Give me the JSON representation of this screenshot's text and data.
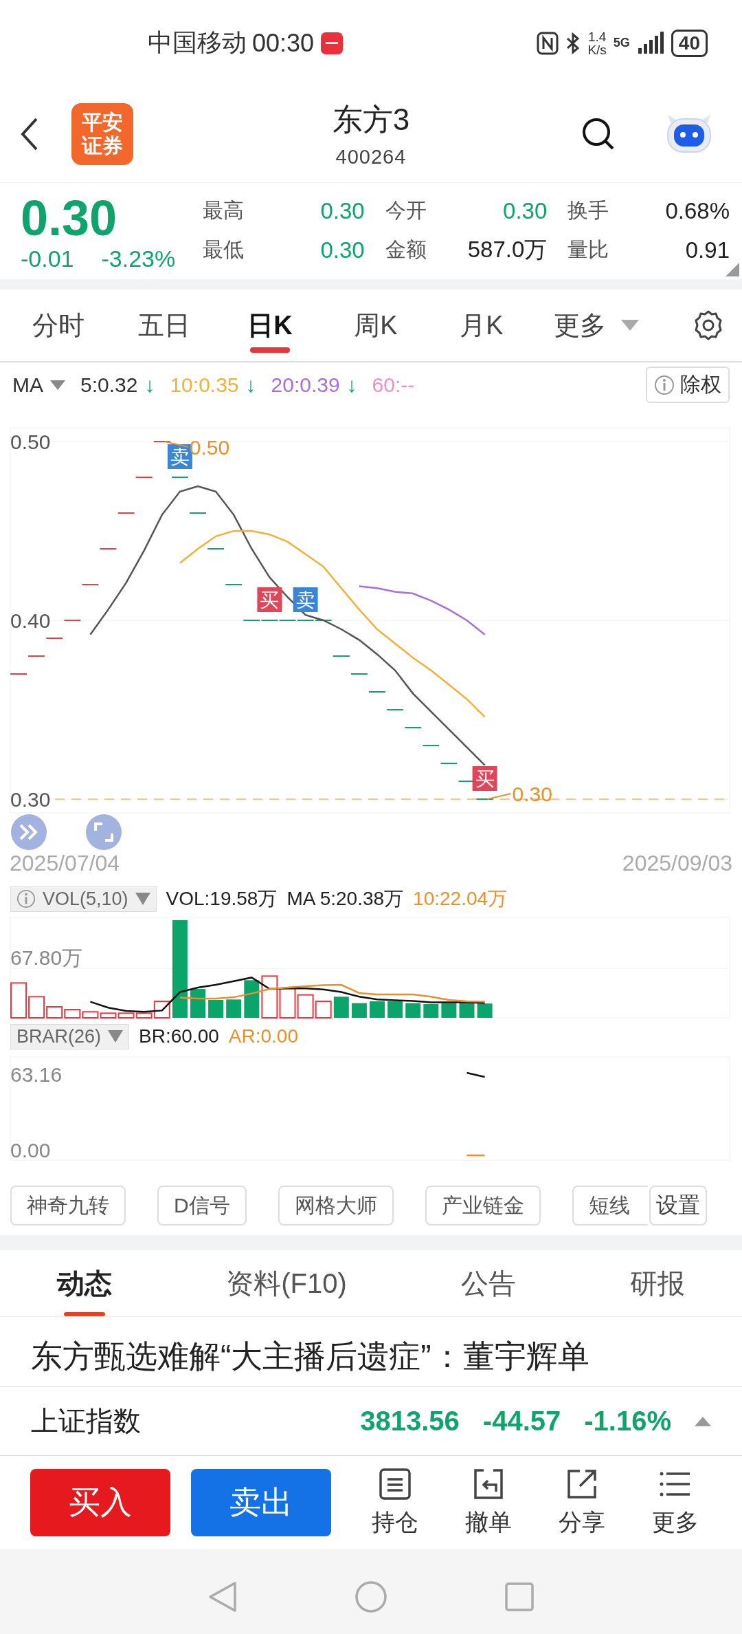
{
  "status_bar": {
    "carrier": "中国移动",
    "time": "00:30",
    "net_speed": "1.4",
    "net_unit": "K/s",
    "network": "5G",
    "battery": "40"
  },
  "header": {
    "logo_lines": [
      "平安",
      "证券"
    ],
    "title": "东方3",
    "code": "400264"
  },
  "quote": {
    "price": "0.30",
    "change": "-0.01",
    "change_pct": "-3.23%",
    "color": "#10a36c",
    "stats": [
      {
        "label": "最高",
        "value": "0.30",
        "color": "#10a36c"
      },
      {
        "label": "今开",
        "value": "0.30",
        "color": "#10a36c"
      },
      {
        "label": "换手",
        "value": "0.68%",
        "color": "#222222"
      },
      {
        "label": "最低",
        "value": "0.30",
        "color": "#10a36c"
      },
      {
        "label": "金额",
        "value": "587.0万",
        "color": "#222222"
      },
      {
        "label": "量比",
        "value": "0.91",
        "color": "#222222"
      }
    ]
  },
  "period_tabs": [
    {
      "label": "分时",
      "selected": false
    },
    {
      "label": "五日",
      "selected": false
    },
    {
      "label": "日K",
      "selected": true
    },
    {
      "label": "周K",
      "selected": false
    },
    {
      "label": "月K",
      "selected": false
    },
    {
      "label": "更多",
      "selected": false
    }
  ],
  "ma_legend": {
    "label": "MA",
    "items": [
      {
        "text": "5:0.32",
        "color": "#333333",
        "arrow": "↓"
      },
      {
        "text": "10:0.35",
        "color": "#f0b13a",
        "arrow": "↓"
      },
      {
        "text": "20:0.39",
        "color": "#a86fd6",
        "arrow": "↓"
      },
      {
        "text": "60:--",
        "color": "#ee8fc8"
      }
    ],
    "adjust_button": "除权"
  },
  "kline": {
    "chart_data": {
      "type": "line",
      "categories": [
        null,
        null,
        null,
        null,
        null,
        null,
        null,
        null,
        null,
        null,
        null,
        null,
        null,
        null,
        null,
        null,
        null,
        null,
        null,
        null,
        null,
        null,
        null,
        null,
        null,
        null,
        null
      ],
      "ylim": [
        0.3,
        0.5
      ],
      "yticks": [
        {
          "value": 0.3,
          "label": "0.30"
        },
        {
          "value": 0.4,
          "label": "0.40"
        },
        {
          "value": 0.5,
          "label": "0.50"
        }
      ],
      "series": [
        {
          "color": "#555555",
          "values": [
            null,
            null,
            null,
            null,
            0.392,
            0.406,
            0.421,
            0.439,
            0.459,
            0.472,
            0.475,
            0.472,
            0.459,
            0.44,
            0.424,
            0.413,
            0.403,
            0.4,
            0.395,
            0.389,
            0.381,
            0.372,
            0.359,
            0.349,
            0.339,
            0.329,
            0.319
          ]
        },
        {
          "color": "#f0b13a",
          "values": [
            null,
            null,
            null,
            null,
            null,
            null,
            null,
            null,
            null,
            0.432,
            0.44,
            0.447,
            0.45,
            0.45,
            0.448,
            0.444,
            0.437,
            0.43,
            0.418,
            0.406,
            0.395,
            0.387,
            0.379,
            0.372,
            0.364,
            0.356,
            0.346
          ]
        },
        {
          "color": "#a86fd6",
          "values": [
            null,
            null,
            null,
            null,
            null,
            null,
            null,
            null,
            null,
            null,
            null,
            null,
            null,
            null,
            null,
            null,
            null,
            null,
            null,
            0.419,
            0.418,
            0.416,
            0.415,
            0.411,
            0.406,
            0.4,
            0.392
          ]
        }
      ]
    },
    "high_label": "0.50",
    "low_label": "0.30",
    "x_start": "2025/07/04",
    "x_end": "2025/09/03",
    "signals": [
      {
        "kind": "sell",
        "label": "卖"
      },
      {
        "kind": "buy",
        "label": "买"
      },
      {
        "kind": "sell",
        "label": "卖"
      },
      {
        "kind": "buy",
        "label": "买"
      }
    ]
  },
  "volume": {
    "indicator": "VOL(5,10)",
    "readings": [
      {
        "text": "VOL:19.58万",
        "color": "#222222"
      },
      {
        "text": "MA 5:20.38万",
        "color": "#222222"
      },
      {
        "text": "10:22.04万",
        "color": "#e8902a"
      }
    ],
    "axis_label": "67.80万"
  },
  "brar": {
    "indicator": "BRAR(26)",
    "readings": [
      {
        "text": "BR:60.00",
        "color": "#222222"
      },
      {
        "text": "AR:0.00",
        "color": "#e8902a"
      }
    ],
    "axis_labels": [
      "63.16",
      "0.00"
    ]
  },
  "tools": [
    "神奇九转",
    "D信号",
    "网格大师",
    "产业链金",
    "短线"
  ],
  "tools_settings": "设置",
  "news_tabs": [
    {
      "label": "动态",
      "selected": true
    },
    {
      "label": "资料(F10)",
      "selected": false
    },
    {
      "label": "公告",
      "selected": false
    },
    {
      "label": "研报",
      "selected": false
    }
  ],
  "headline": "东方甄选难解“大主播后遗症”：董宇辉单",
  "index_bar": {
    "name": "上证指数",
    "value": "3813.56",
    "change": "-44.57",
    "change_pct": "-1.16%",
    "color": "#10a36c"
  },
  "actions": {
    "buy": "买入",
    "sell": "卖出",
    "tools": [
      {
        "kind": "position",
        "label": "持仓"
      },
      {
        "kind": "cancel",
        "label": "撤单"
      },
      {
        "kind": "share",
        "label": "分享"
      },
      {
        "kind": "more",
        "label": "更多"
      }
    ]
  }
}
